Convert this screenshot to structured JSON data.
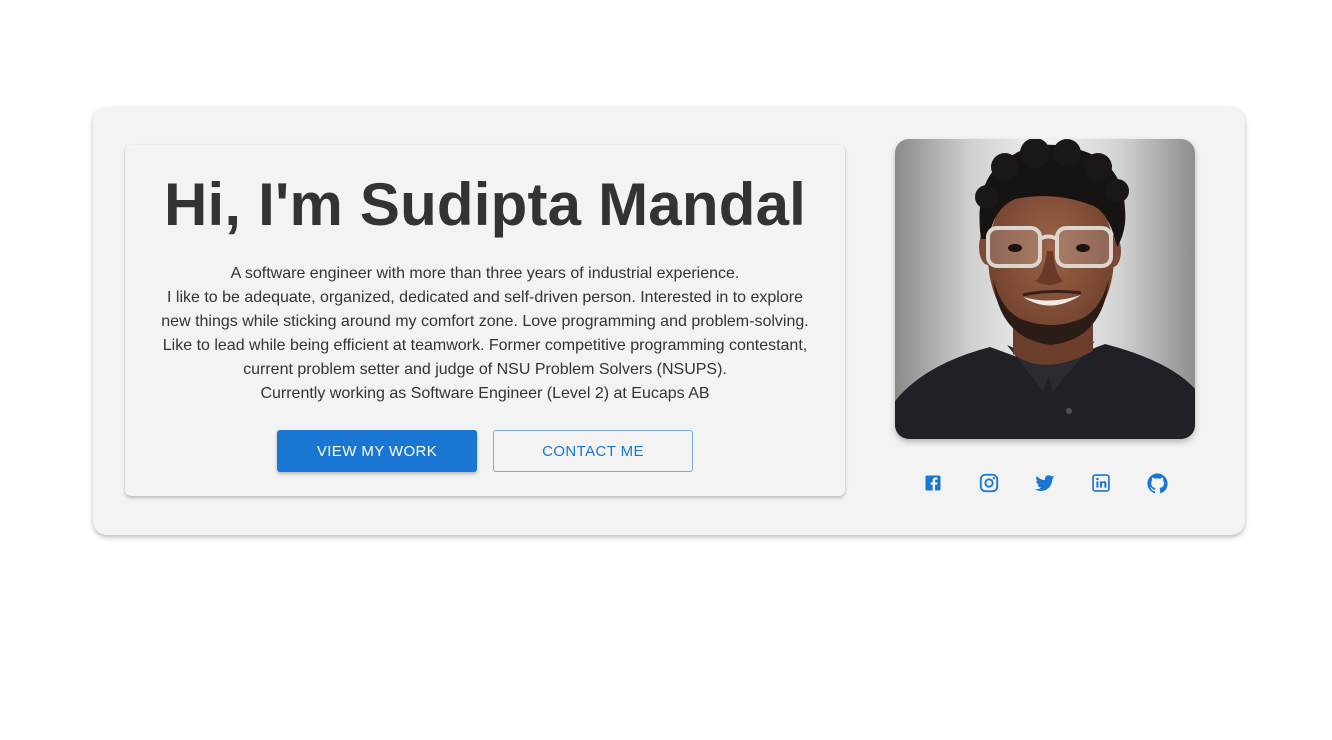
{
  "hero": {
    "title": "Hi, I'm Sudipta Mandal",
    "bio_lines": [
      "A software engineer with more than three years of industrial experience.",
      "I like to be adequate, organized, dedicated and self-driven person. Interested in to explore",
      "new things while sticking around my comfort zone. Love programming and problem-solving.",
      "Like to lead while being efficient at teamwork. Former competitive programming contestant,",
      "current problem setter and judge of NSU Problem Solvers (NSUPS).",
      "Currently working as Software Engineer (Level 2) at Eucaps AB"
    ],
    "primary_button": "VIEW MY WORK",
    "secondary_button": "CONTACT ME"
  },
  "profile": {
    "photo_icon": "profile-photo"
  },
  "social": [
    {
      "icon": "facebook-icon"
    },
    {
      "icon": "instagram-icon"
    },
    {
      "icon": "twitter-icon"
    },
    {
      "icon": "linkedin-icon"
    },
    {
      "icon": "github-icon"
    }
  ],
  "colors": {
    "accent": "#1976d2",
    "card_bg": "#f3f3f3",
    "text": "#333333"
  }
}
